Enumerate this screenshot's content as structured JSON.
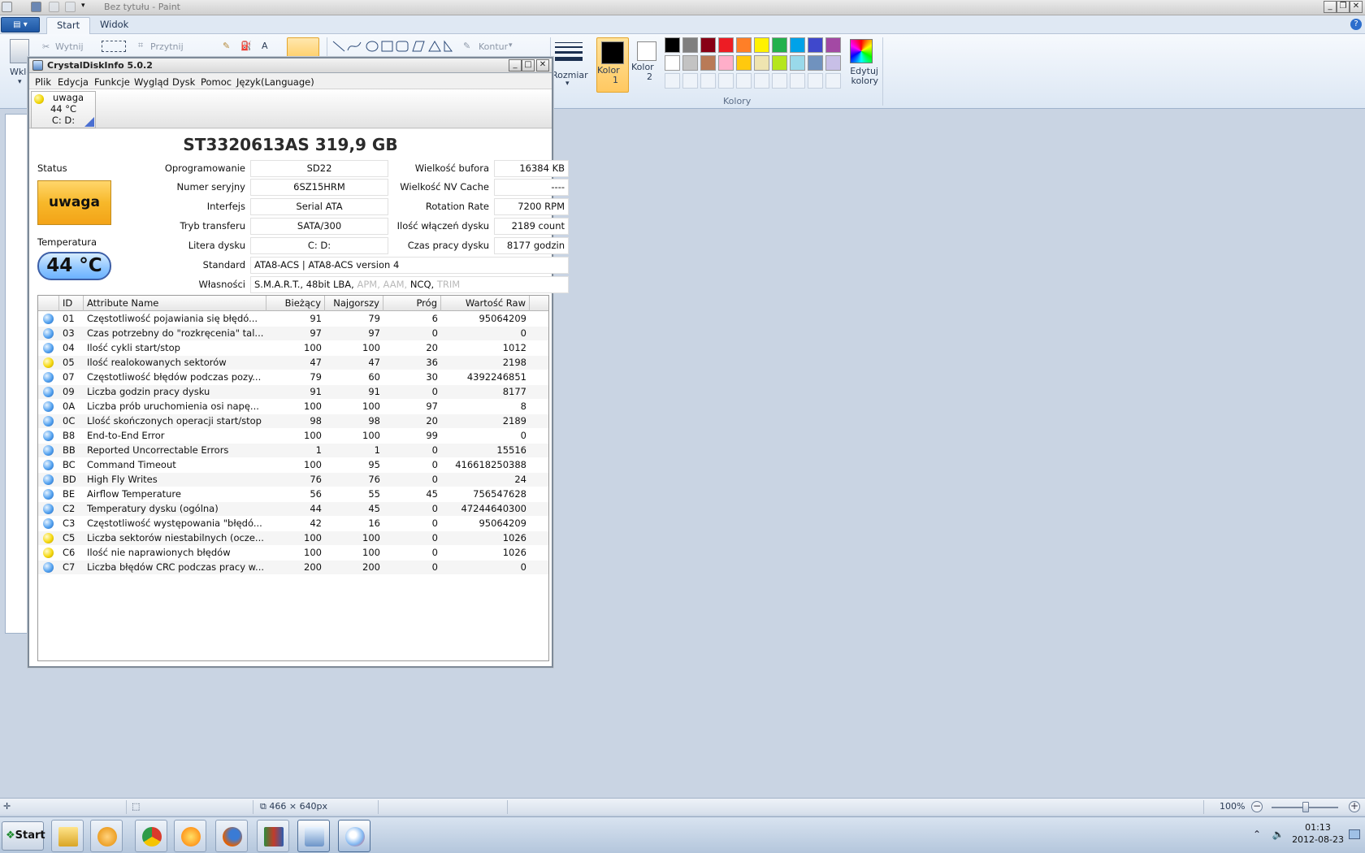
{
  "paint": {
    "title": "Bez tytułu - Paint",
    "tabs": [
      "Start",
      "Widok"
    ],
    "ribbon": {
      "wytnij": "Wytnij",
      "przytnij": "Przytnij",
      "wklej": "Wkle",
      "kontur": "Kontur",
      "rozmiar": "Rozmiar",
      "kolor1": "Kolor 1",
      "kolor2": "Kolor 2",
      "edytuj_kolory": "Edytuj kolory",
      "kolory": "Kolory"
    },
    "palette_row1": [
      "#000000",
      "#7f7f7f",
      "#880015",
      "#ed1c24",
      "#ff7f27",
      "#fff200",
      "#22b14c",
      "#00a2e8",
      "#3f48cc",
      "#a349a4"
    ],
    "palette_row2": [
      "#ffffff",
      "#c3c3c3",
      "#b97a57",
      "#ffaec9",
      "#ffc90e",
      "#efe4b0",
      "#b5e61d",
      "#99d9ea",
      "#7092be",
      "#c8bfe7"
    ],
    "status": {
      "image_size": "466 × 640px",
      "zoom": "100%"
    }
  },
  "taskbar": {
    "start": "Start",
    "time": "01:13",
    "date": "2012-08-23"
  },
  "cdi": {
    "title": "CrystalDiskInfo 5.0.2",
    "menu": [
      "Plik",
      "Edycja",
      "Funkcje",
      "Wygląd",
      "Dysk",
      "Pomoc",
      "Język(Language)"
    ],
    "tab": {
      "status": "uwaga",
      "temp": "44 °C",
      "drives": "C: D:"
    },
    "disk_title": "ST3320613AS  319,9 GB",
    "labels": {
      "status": "Status",
      "temperatura": "Temperatura",
      "oprogramowanie": "Oprogramowanie",
      "numer_seryjny": "Numer seryjny",
      "interfejs": "Interfejs",
      "tryb_transferu": "Tryb transferu",
      "litera_dysku": "Litera dysku",
      "standard": "Standard",
      "wlasnosci": "Własności",
      "wielkosc_bufora": "Wielkość bufora",
      "wielkosc_nv": "Wielkość NV Cache",
      "rotation": "Rotation Rate",
      "ilosc_wlaczen": "Ilość włączeń dysku",
      "czas_pracy": "Czas pracy dysku"
    },
    "values": {
      "status": "uwaga",
      "temperatura": "44 °C",
      "oprogramowanie": "SD22",
      "numer_seryjny": "6SZ15HRM",
      "interfejs": "Serial ATA",
      "tryb_transferu": "SATA/300",
      "litera_dysku": "C: D:",
      "standard": "ATA8-ACS | ATA8-ACS version 4",
      "features_active": "S.M.A.R.T., 48bit LBA,",
      "features_apm": "APM",
      "features_aam": "AAM",
      "features_ncq": "NCQ,",
      "features_trim": "TRIM",
      "wielkosc_bufora": "16384 KB",
      "wielkosc_nv": "----",
      "rotation": "7200 RPM",
      "ilosc_wlaczen": "2189 count",
      "czas_pracy": "8177 godzin"
    },
    "smart_headers": [
      "ID",
      "Attribute Name",
      "Bieżący",
      "Najgorszy",
      "Próg",
      "Wartość Raw"
    ],
    "smart_rows": [
      {
        "status": "blue",
        "id": "01",
        "name": "Częstotliwość pojawiania się błędó...",
        "cur": "91",
        "worst": "79",
        "thr": "6",
        "raw": "95064209"
      },
      {
        "status": "blue",
        "id": "03",
        "name": "Czas potrzebny do \"rozkręcenia\" tal...",
        "cur": "97",
        "worst": "97",
        "thr": "0",
        "raw": "0"
      },
      {
        "status": "blue",
        "id": "04",
        "name": "Ilość cykli start/stop",
        "cur": "100",
        "worst": "100",
        "thr": "20",
        "raw": "1012"
      },
      {
        "status": "yellow",
        "id": "05",
        "name": "Ilość realokowanych sektorów",
        "cur": "47",
        "worst": "47",
        "thr": "36",
        "raw": "2198"
      },
      {
        "status": "blue",
        "id": "07",
        "name": "Częstotliwość błędów podczas pozy...",
        "cur": "79",
        "worst": "60",
        "thr": "30",
        "raw": "4392246851"
      },
      {
        "status": "blue",
        "id": "09",
        "name": "Liczba godzin pracy dysku",
        "cur": "91",
        "worst": "91",
        "thr": "0",
        "raw": "8177"
      },
      {
        "status": "blue",
        "id": "0A",
        "name": "Liczba prób uruchomienia osi napę...",
        "cur": "100",
        "worst": "100",
        "thr": "97",
        "raw": "8"
      },
      {
        "status": "blue",
        "id": "0C",
        "name": "Llość skończonych operacji start/stop",
        "cur": "98",
        "worst": "98",
        "thr": "20",
        "raw": "2189"
      },
      {
        "status": "blue",
        "id": "B8",
        "name": "End-to-End Error",
        "cur": "100",
        "worst": "100",
        "thr": "99",
        "raw": "0"
      },
      {
        "status": "blue",
        "id": "BB",
        "name": "Reported Uncorrectable Errors",
        "cur": "1",
        "worst": "1",
        "thr": "0",
        "raw": "15516"
      },
      {
        "status": "blue",
        "id": "BC",
        "name": "Command Timeout",
        "cur": "100",
        "worst": "95",
        "thr": "0",
        "raw": "416618250388"
      },
      {
        "status": "blue",
        "id": "BD",
        "name": "High Fly Writes",
        "cur": "76",
        "worst": "76",
        "thr": "0",
        "raw": "24"
      },
      {
        "status": "blue",
        "id": "BE",
        "name": "Airflow Temperature",
        "cur": "56",
        "worst": "55",
        "thr": "45",
        "raw": "756547628"
      },
      {
        "status": "blue",
        "id": "C2",
        "name": "Temperatury dysku (ogólna)",
        "cur": "44",
        "worst": "45",
        "thr": "0",
        "raw": "47244640300"
      },
      {
        "status": "blue",
        "id": "C3",
        "name": "Częstotliwość występowania \"błędó...",
        "cur": "42",
        "worst": "16",
        "thr": "0",
        "raw": "95064209"
      },
      {
        "status": "yellow",
        "id": "C5",
        "name": "Liczba sektorów niestabilnych (ocze...",
        "cur": "100",
        "worst": "100",
        "thr": "0",
        "raw": "1026"
      },
      {
        "status": "yellow",
        "id": "C6",
        "name": "Ilość nie naprawionych błędów",
        "cur": "100",
        "worst": "100",
        "thr": "0",
        "raw": "1026"
      },
      {
        "status": "blue",
        "id": "C7",
        "name": "Liczba błędów CRC podczas pracy w...",
        "cur": "200",
        "worst": "200",
        "thr": "0",
        "raw": "0"
      }
    ]
  }
}
